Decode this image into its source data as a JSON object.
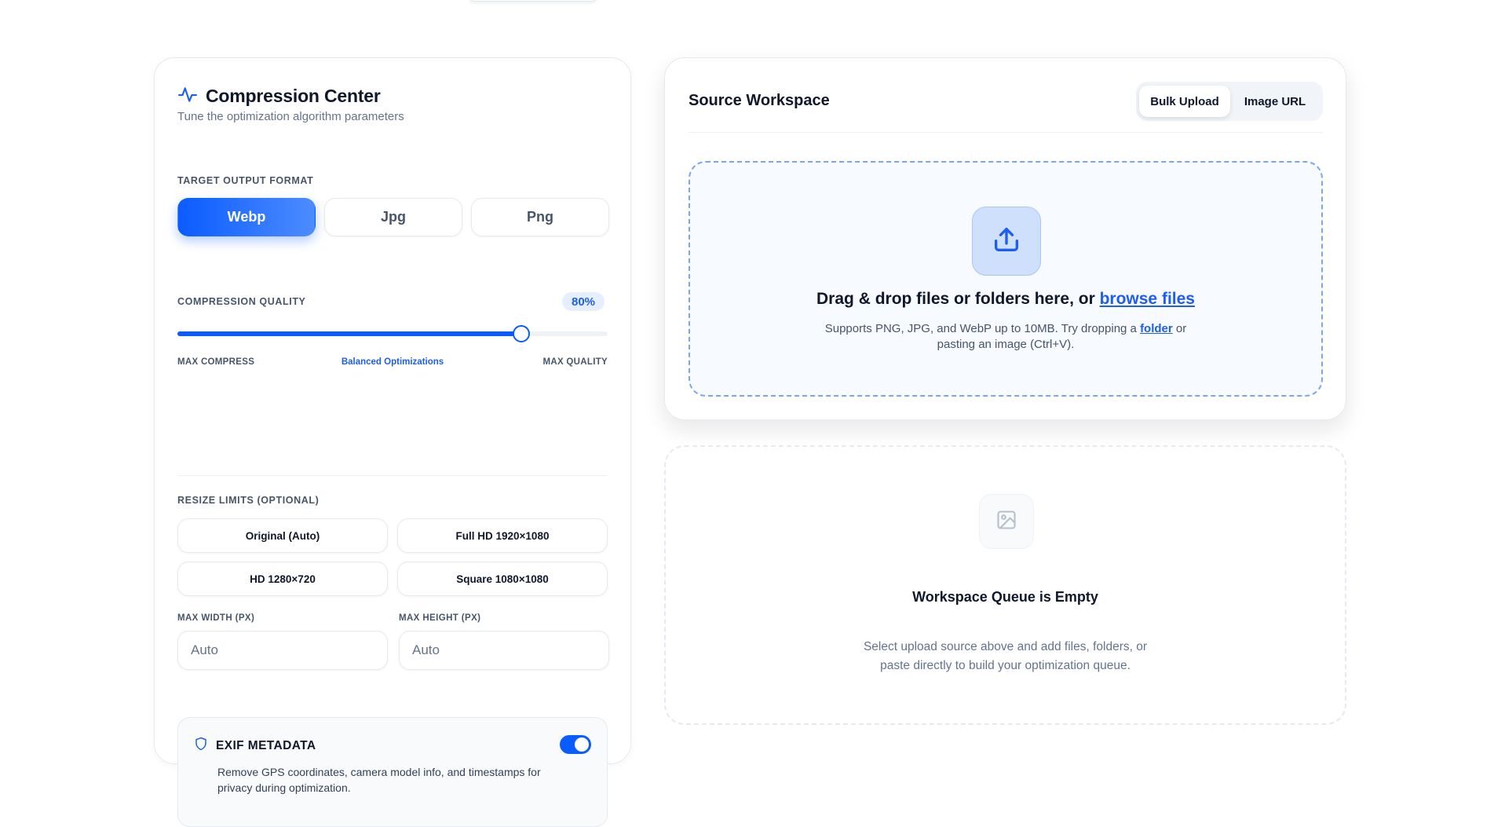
{
  "compression": {
    "title": "Compression Center",
    "subtitle": "Tune the optimization algorithm parameters",
    "format_label": "TARGET OUTPUT FORMAT",
    "formats": [
      "Webp",
      "Jpg",
      "Png"
    ],
    "selected_format": "Webp",
    "quality_label": "COMPRESSION QUALITY",
    "quality_value": 80,
    "quality_display": "80%",
    "slider_min_label": "MAX COMPRESS",
    "slider_mid_label": "Balanced Optimizations",
    "slider_max_label": "MAX QUALITY",
    "resize_label": "RESIZE LIMITS (OPTIONAL)",
    "resize_presets": [
      "Original (Auto)",
      "Full HD 1920×1080",
      "HD 1280×720",
      "Square 1080×1080"
    ],
    "max_width_label": "MAX WIDTH (PX)",
    "max_width_placeholder": "Auto",
    "max_height_label": "MAX HEIGHT (PX)",
    "max_height_placeholder": "Auto",
    "exif": {
      "title": "EXIF METADATA",
      "enabled": true,
      "description": "Remove GPS coordinates, camera model info, and timestamps for privacy during optimization."
    }
  },
  "source": {
    "title": "Source Workspace",
    "tabs": [
      "Bulk Upload",
      "Image URL"
    ],
    "active_tab": "Bulk Upload",
    "drop_heading": "Drag & drop files or folders here, or ",
    "drop_link": "browse files",
    "drop_sub_1": "Supports PNG, JPG, and WebP up to 10MB. Try dropping a ",
    "drop_sub_link": "folder",
    "drop_sub_2": " or",
    "drop_sub_3": "pasting an image (Ctrl+V)."
  },
  "queue": {
    "title": "Workspace Queue is Empty",
    "description_1": "Select upload source above and add files, folders, or",
    "description_2": "paste directly to build your optimization queue."
  },
  "colors": {
    "accent": "#0b5cff",
    "accent_text": "#1d5ef0"
  },
  "icons": {
    "title": "activity-pulse-icon",
    "exif": "shield-icon",
    "upload": "upload-icon",
    "queue": "image-placeholder-icon"
  }
}
